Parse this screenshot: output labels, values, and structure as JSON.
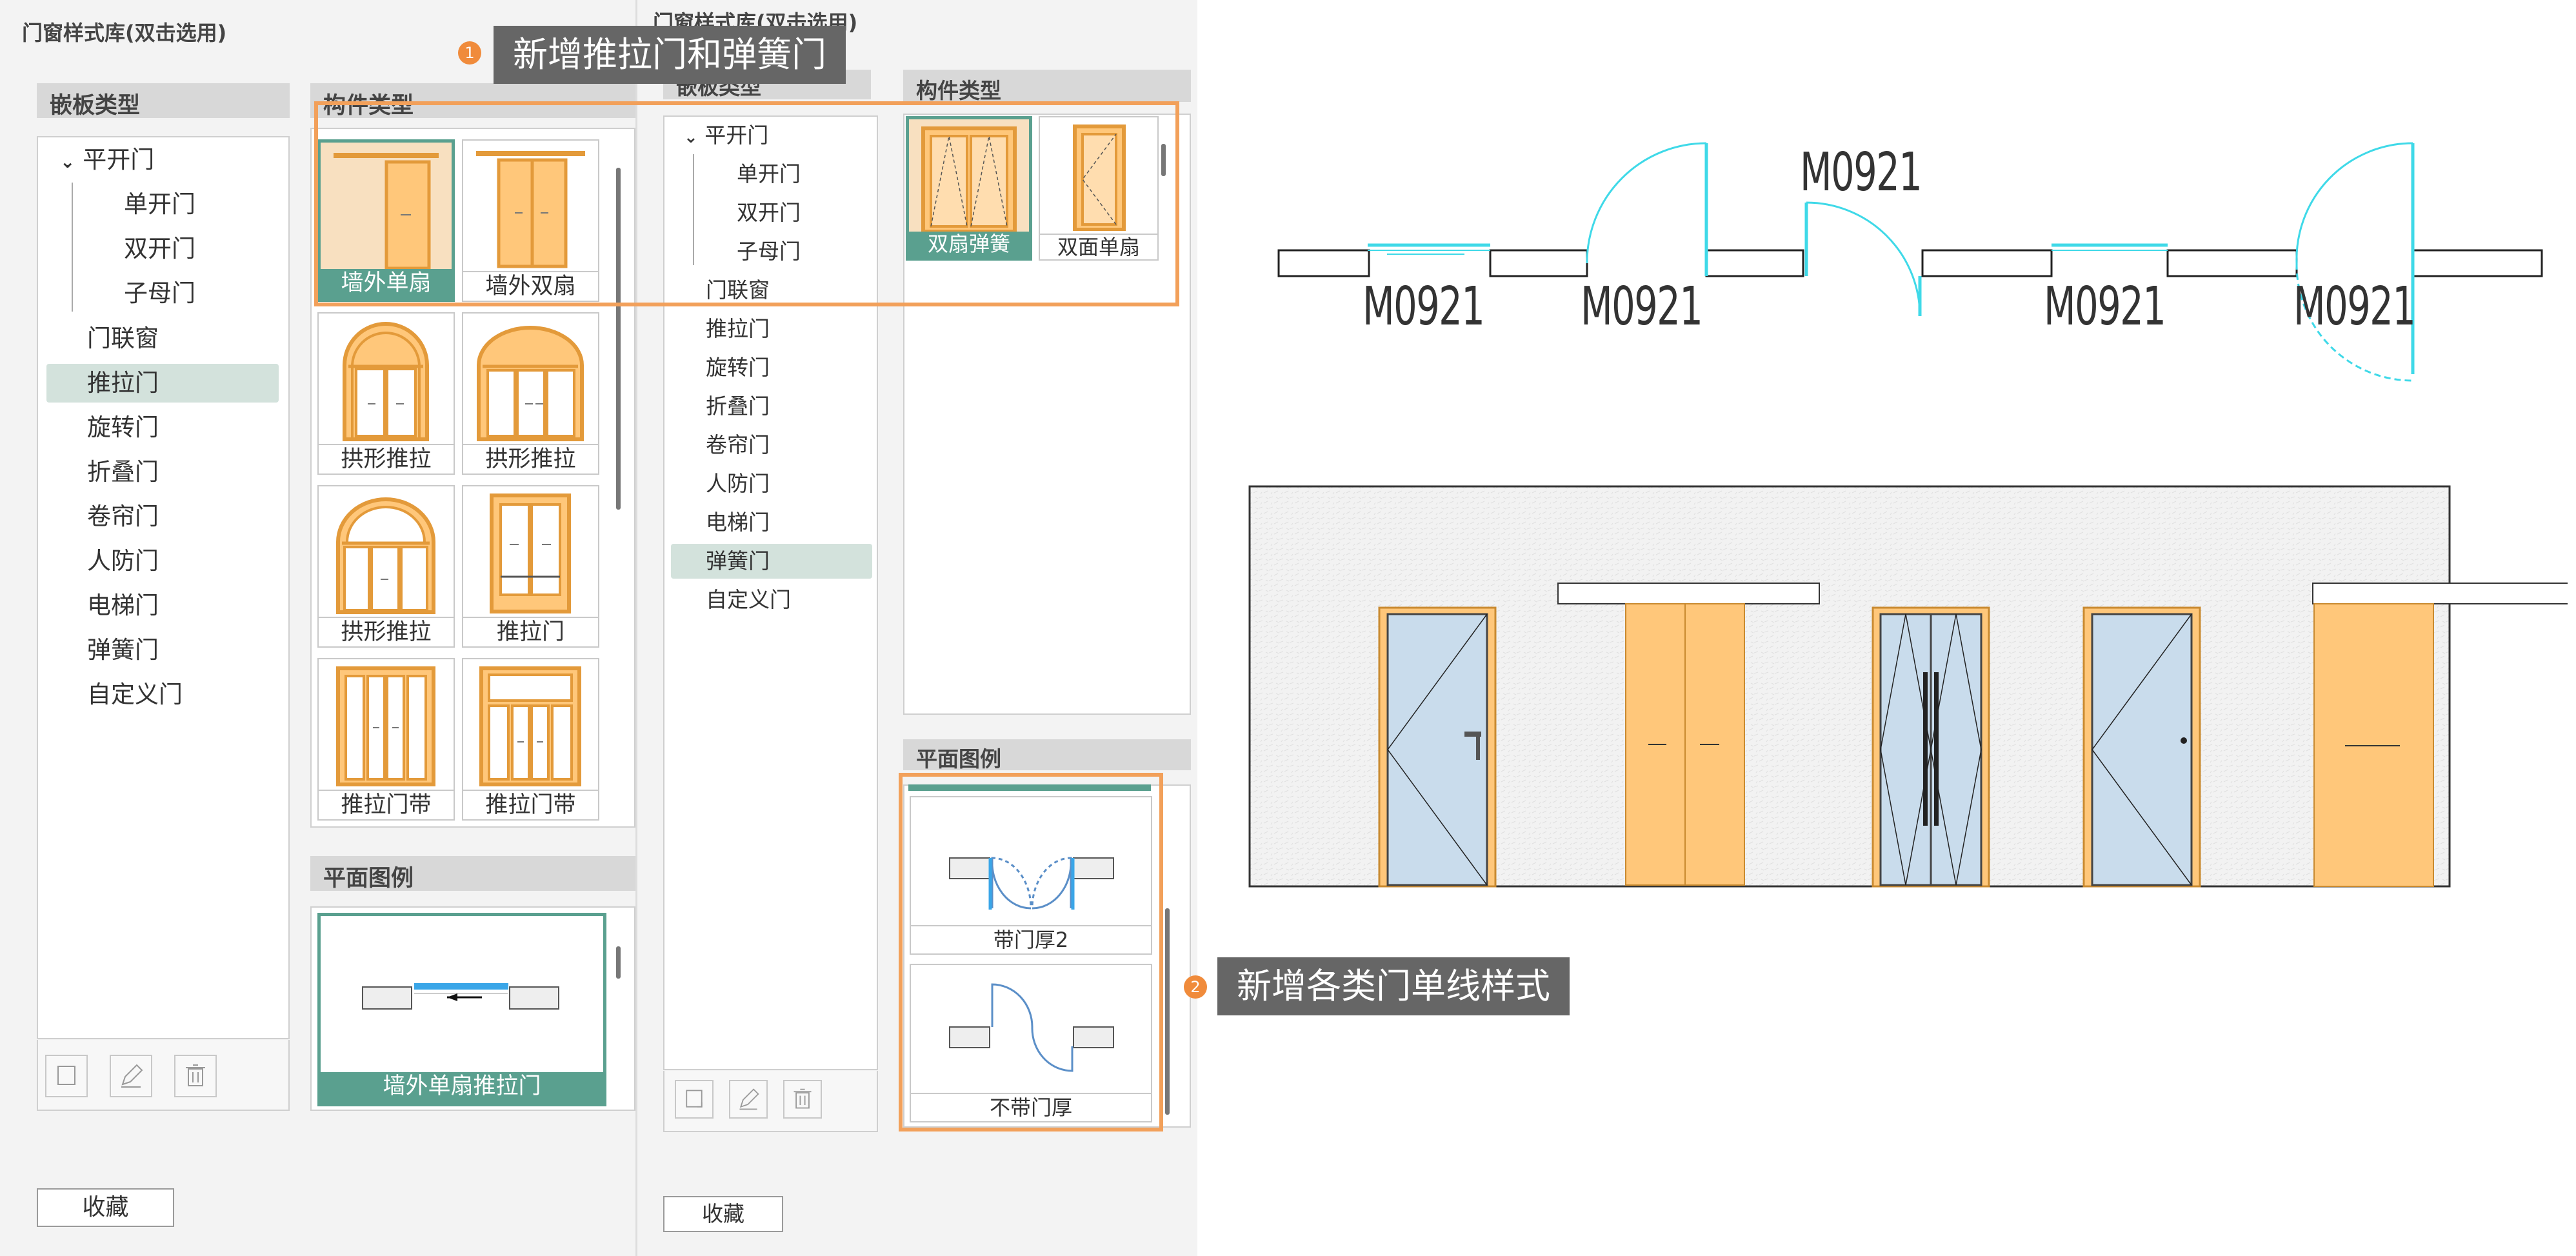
{
  "left_dialog": {
    "title": "门窗样式库(双击选用)",
    "inlay_header": "嵌板类型",
    "component_header": "构件类型",
    "legend_header": "平面图例",
    "tree": {
      "root": "平开门",
      "children": [
        "单开门",
        "双开门",
        "子母门"
      ],
      "items": [
        "门联窗",
        "推拉门",
        "旋转门",
        "折叠门",
        "卷帘门",
        "人防门",
        "电梯门",
        "弹簧门",
        "自定义门"
      ]
    },
    "tiles": [
      "墙外单扇",
      "墙外双扇",
      "拱形推拉",
      "拱形推拉",
      "拱形推拉",
      "推拉门",
      "推拉门带",
      "推拉门带"
    ],
    "legend_caption": "墙外单扇推拉门",
    "favorite": "收藏"
  },
  "right_dialog": {
    "title": "门窗样式库(双击选用)",
    "inlay_header": "嵌板类型",
    "component_header": "构件类型",
    "legend_header": "平面图例",
    "tree": {
      "root": "平开门",
      "children": [
        "单开门",
        "双开门",
        "子母门"
      ],
      "items": [
        "门联窗",
        "推拉门",
        "旋转门",
        "折叠门",
        "卷帘门",
        "人防门",
        "电梯门",
        "弹簧门",
        "自定义门"
      ]
    },
    "tiles": [
      "双扇弹簧",
      "双面单扇"
    ],
    "legend_captions": [
      "带门厚2",
      "不带门厚"
    ],
    "favorite": "收藏"
  },
  "callouts": {
    "one": {
      "num": "1",
      "text": "新增推拉门和弹簧门"
    },
    "two": {
      "num": "2",
      "text": "新增各类门单线样式"
    }
  },
  "plan_labels": {
    "top": "M0921",
    "bottom": [
      "M0921",
      "M0921",
      "M0921",
      "M0921"
    ]
  },
  "colors": {
    "accent": "#f08b3b",
    "selected": "#5aa08f",
    "door_fill": "#ffc77a",
    "glass": "#c9dcec",
    "cyan": "#3fd9e8"
  },
  "icons": [
    "new-icon",
    "edit-icon",
    "delete-icon",
    "chevron-down-icon"
  ]
}
